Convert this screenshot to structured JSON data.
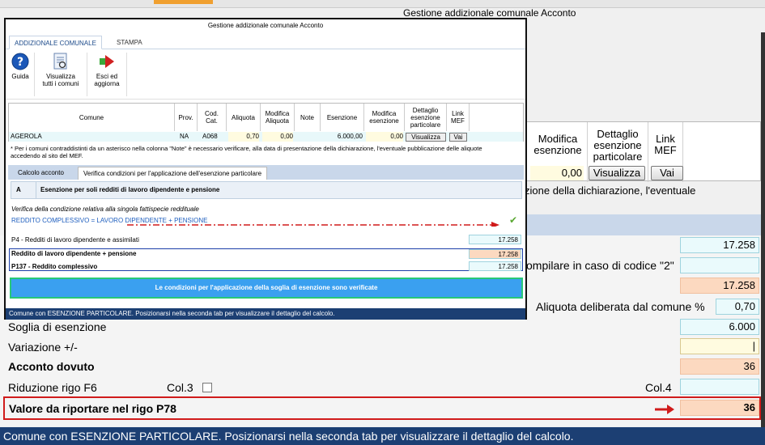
{
  "bg": {
    "title": "Gestione addizionale comunale Acconto",
    "table": {
      "col_modifica_esenzione": "Modifica esenzione",
      "col_dettaglio": "Dettaglio esenzione particolare",
      "col_link_mef": "Link MEF",
      "modifica_esenzione_value": "0,00",
      "visualizza_btn": "Visualizza",
      "vai_btn": "Vai"
    },
    "note_tail": "zione della dichiarazione, l'eventuale",
    "rows": {
      "r1_value": "17.258",
      "compilare_label": "ompilare in caso di codice \"2\"",
      "r3_value": "17.258",
      "aliquota_label": "Aliquota deliberata dal comune %",
      "aliquota_value": "0,70",
      "soglia_label": "Soglia di esenzione",
      "soglia_value": "6.000",
      "variazione_label": "Variazione +/-",
      "acconto_label": "Acconto dovuto",
      "acconto_value": "36",
      "riduzione_label": "Riduzione rigo F6",
      "col3_label": "Col.3",
      "col4_label": "Col.4",
      "valore_label": "Valore da riportare nel rigo P78",
      "valore_value": "36"
    },
    "status": "Comune con ESENZIONE PARTICOLARE. Posizionarsi nella seconda tab per visualizzare il dettaglio del calcolo."
  },
  "dialog": {
    "title": "Gestione addizionale comunale Acconto",
    "tabs": [
      "ADDIZIONALE COMUNALE",
      "STAMPA"
    ],
    "ribbon": {
      "guida": "Guida",
      "visualizza_line1": "Visualizza",
      "visualizza_line2": "tutti i comuni",
      "esci_line1": "Esci ed",
      "esci_line2": "aggiorna"
    },
    "table": {
      "headers": {
        "comune": "Comune",
        "prov": "Prov.",
        "cod_cat_1": "Cod.",
        "cod_cat_2": "Cat.",
        "aliquota": "Aliquota",
        "mod_aliquota_1": "Modifica",
        "mod_aliquota_2": "Aliquota",
        "note": "Note",
        "esenzione": "Esenzione",
        "mod_esenzione_1": "Modifica",
        "mod_esenzione_2": "esenzione",
        "dettaglio_1": "Dettaglio",
        "dettaglio_2": "esenzione",
        "dettaglio_3": "particolare",
        "link_1": "Link",
        "link_2": "MEF"
      },
      "row": {
        "comune": "AGEROLA",
        "prov": "NA",
        "cod_cat": "A068",
        "aliquota": "0,70",
        "mod_aliquota": "0,00",
        "note": "",
        "esenzione": "6.000,00",
        "mod_esenzione": "0,00",
        "visualizza": "Visualizza",
        "vai": "Vai"
      }
    },
    "note": "* Per i comuni contraddistinti da un asterisco nella colonna \"Note\" è necessario verificare,  alla data di presentazione della dichiarazione, l'eventuale pubblicazione delle aliquote accedendo al sito del MEF.",
    "inner_tabs": [
      "Calcolo acconto",
      "Verifica condizioni per l'applicazione dell'esenzione particolare"
    ],
    "section": {
      "letter": "A",
      "title": "Esenzione per soli redditi di lavoro dipendente e pensione"
    },
    "verifica_text": "Verifica della condizione relativa alla singola fattispecie reddituale",
    "formula_text": "REDDITO COMPLESSIVO = LAVORO DIPENDENTE + PENSIONE",
    "p4_label": "P4 - Redditi di lavoro dipendente e assimilati",
    "p4_value": "17.258",
    "r1_label": "Reddito di lavoro dipendente + pensione",
    "r1_value": "17.258",
    "r2_label": "P137 - Reddito complessivo",
    "r2_value": "17.258",
    "banner": "Le condizioni per l'applicazione della soglia di esenzione sono verificate",
    "status": "Comune con ESENZIONE PARTICOLARE. Posizionarsi nella seconda tab per visualizzare il dettaglio del calcolo."
  },
  "colors": {
    "status_bar": "#1c3f73",
    "banner_blue": "#3aa0f0",
    "banner_border": "#28c878",
    "highlight_red": "#d01b1b",
    "peach_field": "#fcd9c0",
    "cyan_field": "#eafafc"
  }
}
